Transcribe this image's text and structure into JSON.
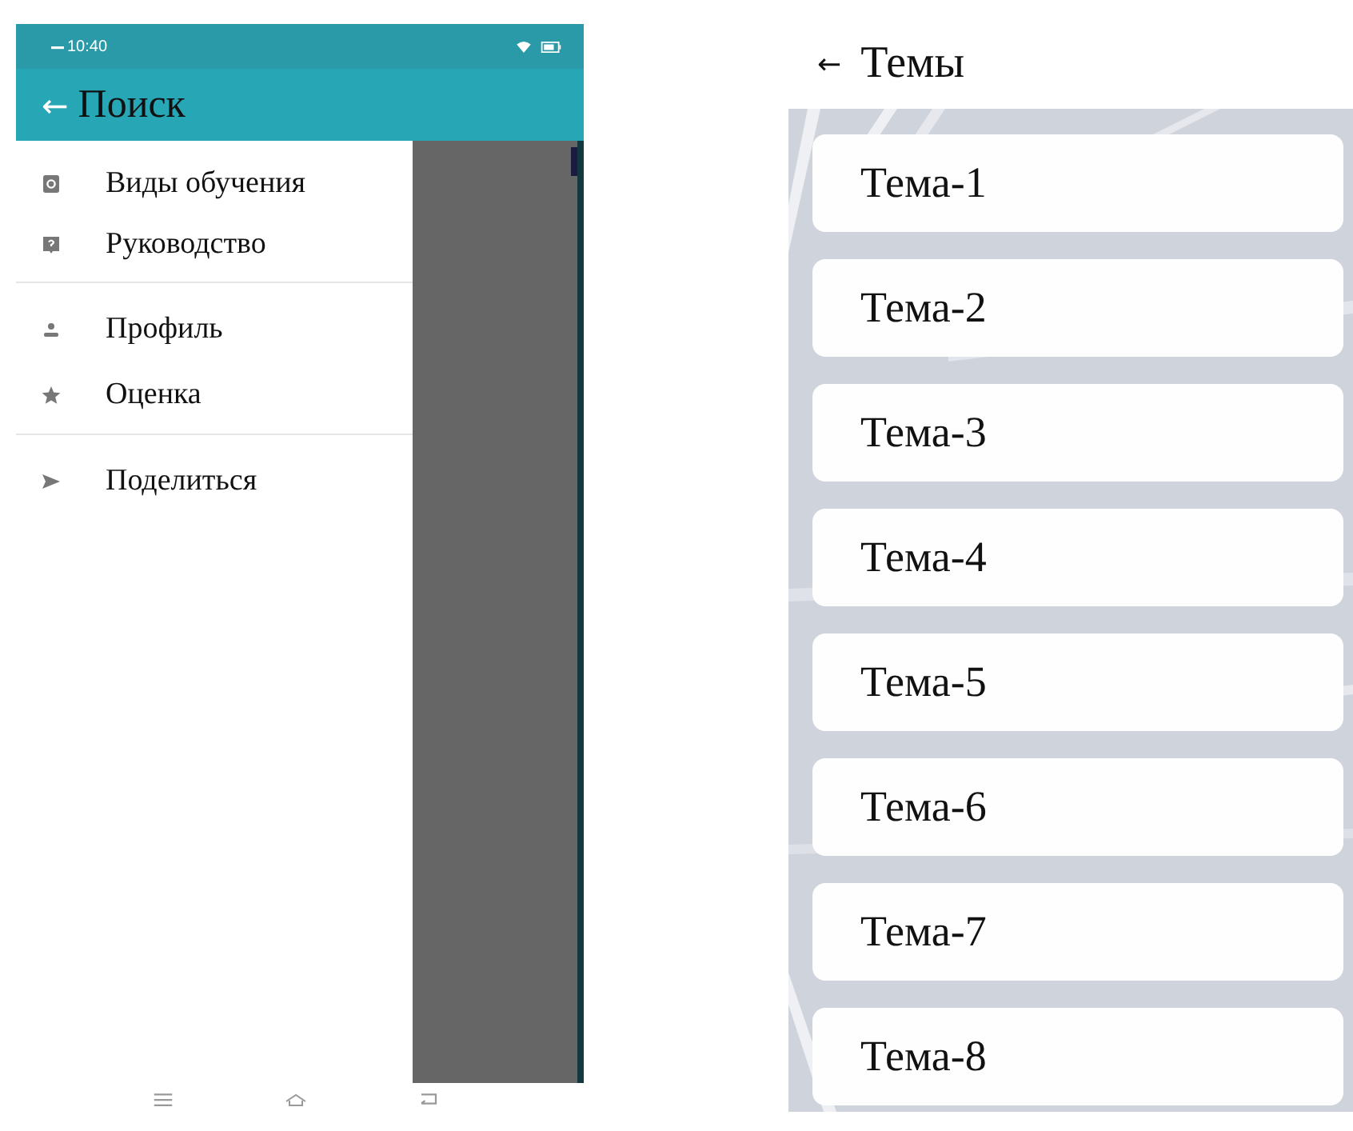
{
  "left_screen": {
    "status_bar": {
      "time": "10:40"
    },
    "app_bar": {
      "back": "←",
      "title": "Поиск"
    },
    "drawer": {
      "sections": [
        {
          "items": [
            {
              "label": "Виды обучения"
            },
            {
              "label": "Руководство"
            }
          ]
        },
        {
          "items": [
            {
              "label": "Профиль"
            },
            {
              "label": "Оценка"
            }
          ]
        },
        {
          "items": [
            {
              "label": "Поделиться"
            }
          ]
        }
      ]
    }
  },
  "right_screen": {
    "header": {
      "back": "←",
      "title": "Темы"
    },
    "topics": [
      {
        "label": "Тема-1"
      },
      {
        "label": "Тема-2"
      },
      {
        "label": "Тема-3"
      },
      {
        "label": "Тема-4"
      },
      {
        "label": "Тема-5"
      },
      {
        "label": "Тема-6"
      },
      {
        "label": "Тема-7"
      },
      {
        "label": "Тема-8"
      }
    ]
  }
}
